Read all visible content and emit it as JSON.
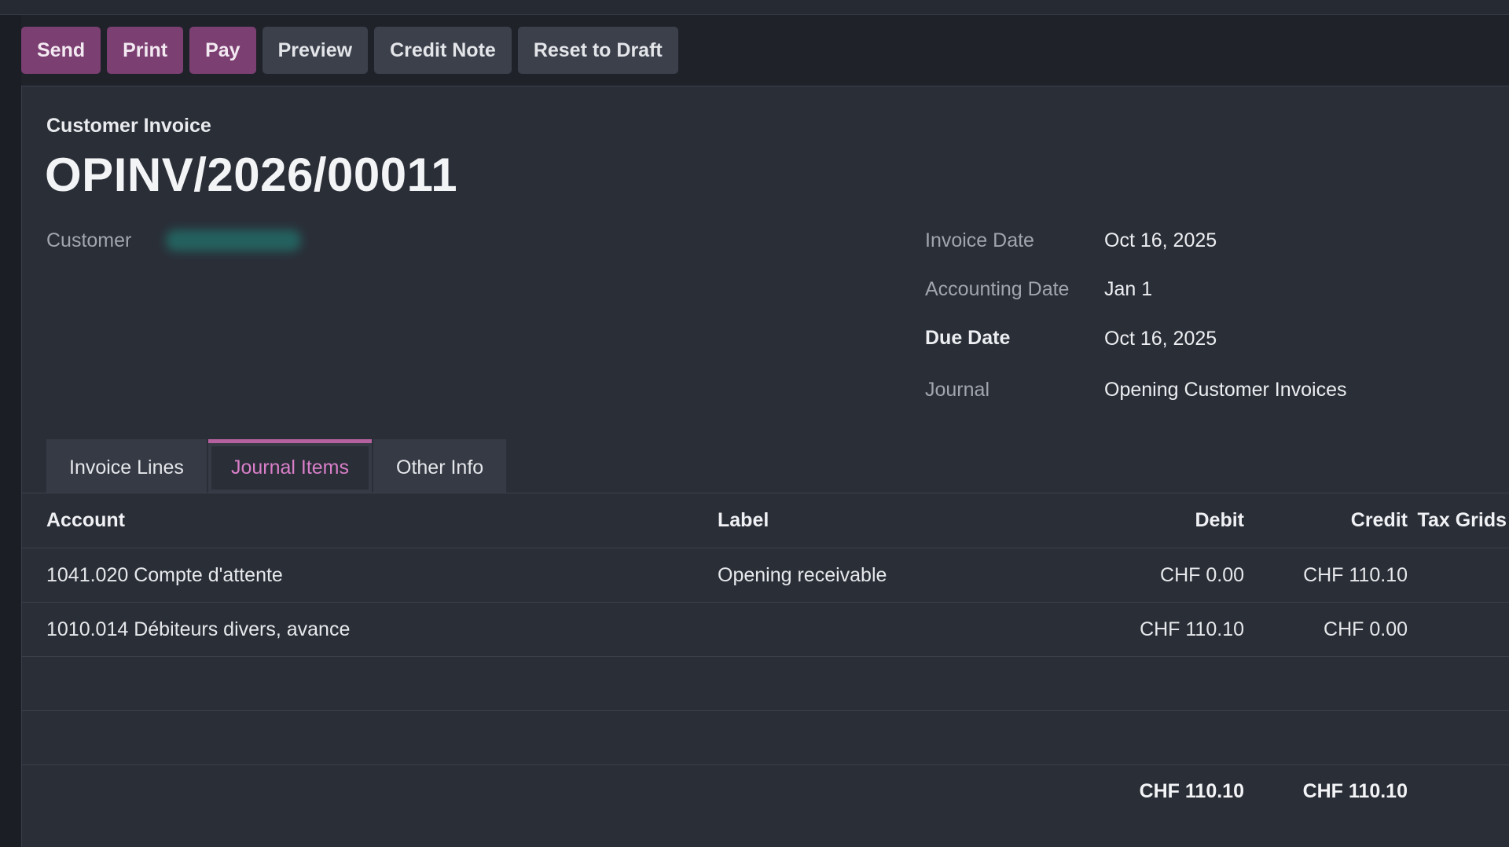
{
  "toolbar": {
    "buttons": [
      {
        "label": "Send"
      },
      {
        "label": "Print"
      },
      {
        "label": "Pay"
      },
      {
        "label": "Preview"
      },
      {
        "label": "Credit Note"
      },
      {
        "label": "Reset to Draft"
      }
    ]
  },
  "invoice": {
    "type_label": "Customer Invoice",
    "number": "OPINV/2026/00011",
    "customer_label": "Customer",
    "invoice_date_label": "Invoice Date",
    "invoice_date": "Oct 16, 2025",
    "accounting_date_label": "Accounting Date",
    "accounting_date": "Jan 1",
    "due_date_label": "Due Date",
    "due_date": "Oct 16, 2025",
    "journal_label": "Journal",
    "journal": "Opening Customer Invoices"
  },
  "tabs": [
    {
      "label": "Invoice Lines",
      "active": false
    },
    {
      "label": "Journal Items",
      "active": true
    },
    {
      "label": "Other Info",
      "active": false
    }
  ],
  "journal_items": {
    "columns": {
      "account": "Account",
      "label": "Label",
      "debit": "Debit",
      "credit": "Credit",
      "tax_grids": "Tax Grids"
    },
    "rows": [
      {
        "account": "1041.020 Compte d'attente",
        "label": "Opening receivable",
        "debit": "CHF 0.00",
        "credit": "CHF 110.10"
      },
      {
        "account": "1010.014 Débiteurs divers, avance",
        "label": "",
        "debit": "CHF 110.10",
        "credit": "CHF 0.00"
      }
    ],
    "totals": {
      "debit": "CHF 110.10",
      "credit": "CHF 110.10"
    }
  },
  "colors": {
    "primary_button": "#7b3f72",
    "active_tab_accent": "#b5619f",
    "background": "#2a2e37"
  }
}
